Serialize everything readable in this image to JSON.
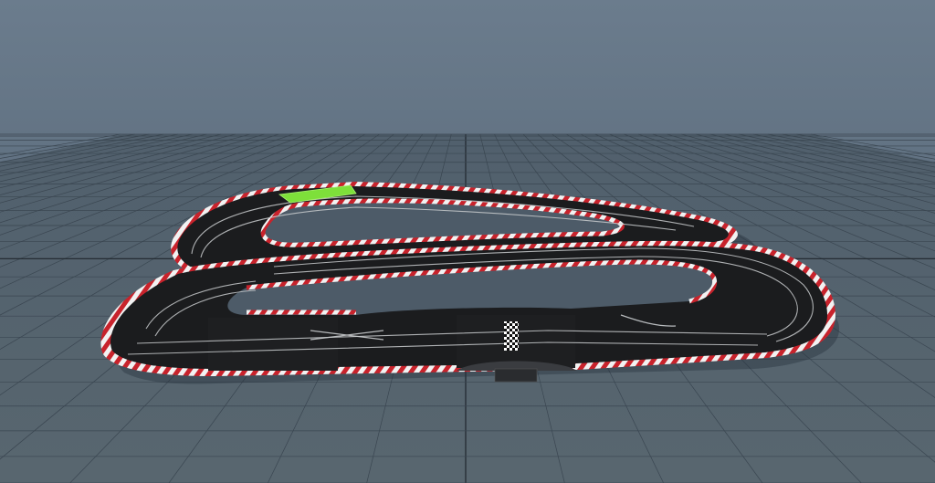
{
  "scene": {
    "sky_top_color": "#6b7c8d",
    "sky_bottom_color": "#4f5f6e",
    "floor_color": "#54626f",
    "grid_color": "#3a4651",
    "grid_axis_color": "#1f262d",
    "asphalt_color": "#1b1c1e",
    "lane_line_color": "#c9ccce",
    "kerb_red": "#c8232c",
    "kerb_white": "#f2f2f2",
    "highlight_piece_color": "#7ee03a"
  }
}
